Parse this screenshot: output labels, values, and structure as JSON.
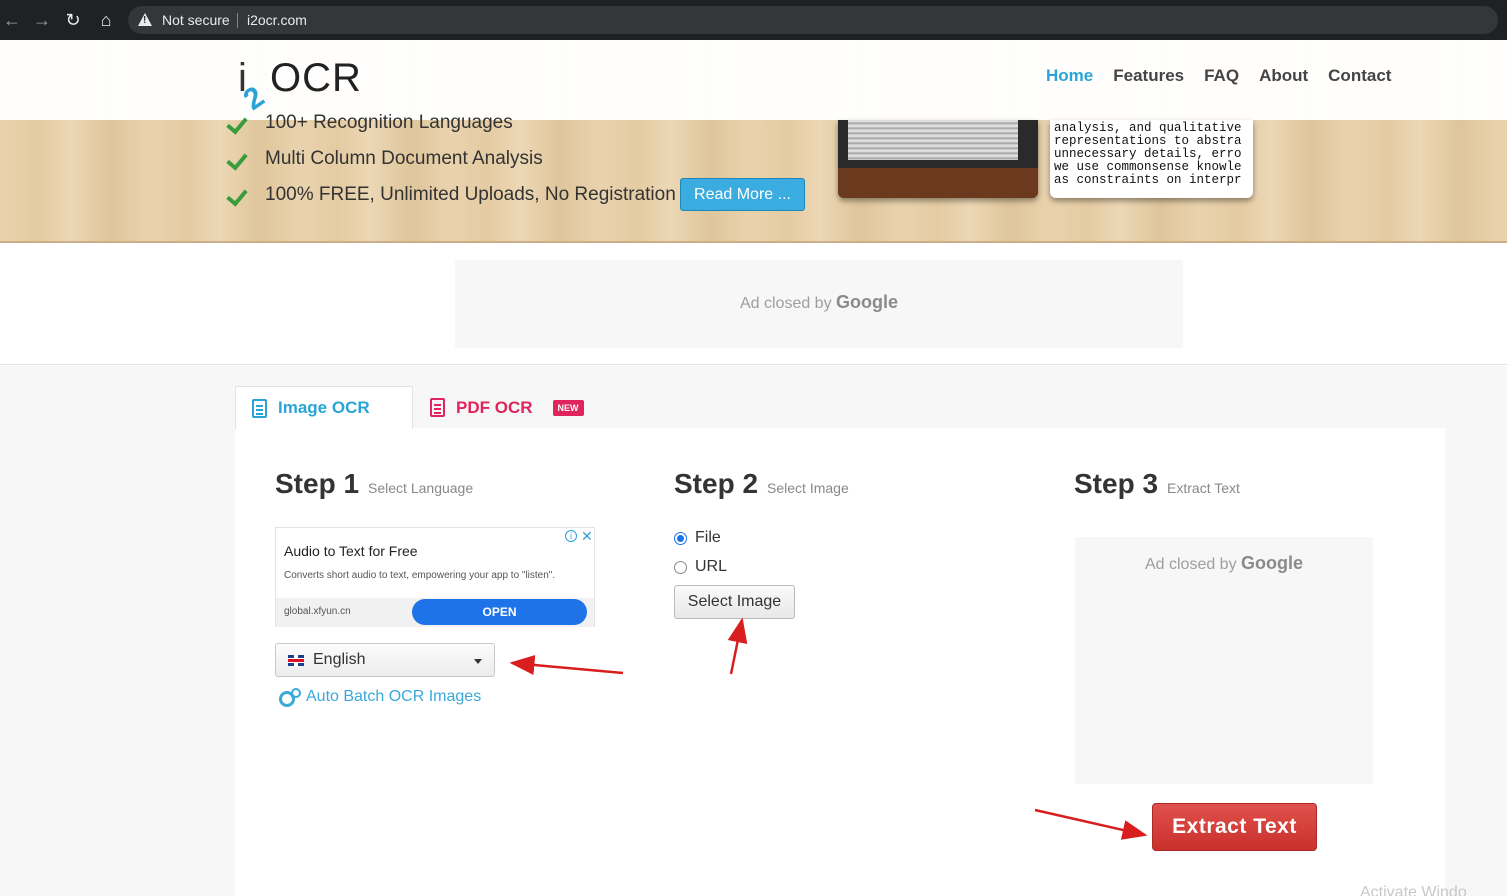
{
  "browser": {
    "security_label": "Not secure",
    "url": "i2ocr.com"
  },
  "header": {
    "logo_i": "i",
    "logo_2": "2",
    "logo_ocr": "OCR",
    "nav": [
      "Home",
      "Features",
      "FAQ",
      "About",
      "Contact"
    ],
    "active_nav": "Home"
  },
  "hero": {
    "features": [
      "100+ Recognition Languages",
      "Multi Column Document Analysis",
      "100% FREE, Unlimited Uploads, No Registration"
    ],
    "read_more": "Read More ...",
    "sample_text": "analysis, and qualitative\nrepresentations to abstra\nunnecessary details, erro\nwe use commonsense knowle\nas constraints on interpr"
  },
  "ad_top": {
    "text": "Ad closed by",
    "brand": "Google"
  },
  "tabs": [
    {
      "label": "Image OCR",
      "active": true
    },
    {
      "label": "PDF OCR",
      "badge": "NEW",
      "active": false
    }
  ],
  "step1": {
    "title": "Step 1",
    "subtitle": "Select Language",
    "ad": {
      "title": "Audio to Text for Free",
      "description": "Converts short audio to text, empowering your app to \"listen\".",
      "domain": "global.xfyun.cn",
      "cta": "OPEN",
      "info": "i",
      "close": "✕"
    },
    "language": "English",
    "batch_link": "Auto Batch OCR Images"
  },
  "step2": {
    "title": "Step 2",
    "subtitle": "Select Image",
    "options": [
      {
        "label": "File",
        "checked": true
      },
      {
        "label": "URL",
        "checked": false
      }
    ],
    "select_button": "Select Image"
  },
  "step3": {
    "title": "Step 3",
    "subtitle": "Extract Text",
    "ad_text": "Ad closed by",
    "ad_brand": "Google",
    "extract_button": "Extract Text"
  },
  "watermark": "Activate Windo",
  "colors": {
    "accent": "#2aa4d6",
    "pdf": "#e0245e",
    "extract": "#c9302c",
    "arrow": "#d81e1e"
  }
}
